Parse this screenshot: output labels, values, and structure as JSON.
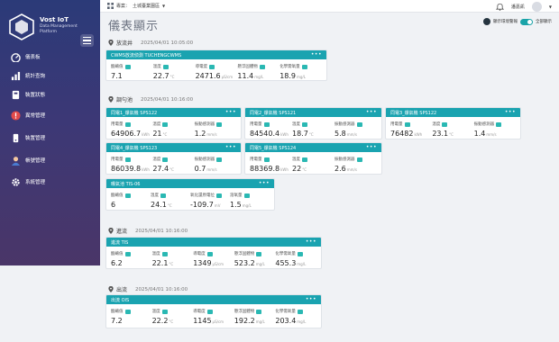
{
  "sidebar": {
    "brand_title": "Vost IoT",
    "brand_sub": "Data Management Platform",
    "items": [
      {
        "label": "儀表板",
        "icon": "dashboard-icon"
      },
      {
        "label": "統計查詢",
        "icon": "statistics-icon"
      },
      {
        "label": "裝置狀態",
        "icon": "device-status-icon"
      },
      {
        "label": "異常管理",
        "icon": "alert-icon"
      },
      {
        "label": "裝置管理",
        "icon": "device-icon"
      },
      {
        "label": "帳號管理",
        "icon": "user-icon"
      },
      {
        "label": "系統管理",
        "icon": "gear-icon"
      }
    ]
  },
  "topbar": {
    "region_label": "專案：",
    "region_value": "土城臺業園區",
    "user": "潘嘉凱"
  },
  "page": {
    "title": "儀表顯示",
    "toggle1_label": "顯示環境警報",
    "toggle2_label": "全部顯示"
  },
  "sections": [
    {
      "name": "放流井",
      "time": "2025/04/01 10:05:00",
      "cards": [
        {
          "title": "CWMS放流偵測 TUCHENGCWMS",
          "metrics": [
            {
              "label": "酸鹼值",
              "value": "7.1",
              "unit": ""
            },
            {
              "label": "溫度",
              "value": "22.7",
              "unit": "°C"
            },
            {
              "label": "導電度",
              "value": "2471.6",
              "unit": "µS/cm"
            },
            {
              "label": "懸浮固體物",
              "value": "11.4",
              "unit": "mg/L"
            },
            {
              "label": "化學需氧量",
              "value": "18.9",
              "unit": "mg/L"
            }
          ]
        }
      ]
    },
    {
      "name": "調勻池",
      "time": "2025/04/01 10:16:00",
      "cards": [
        {
          "title": "同電1_爆氣機 SPS122",
          "metrics": [
            {
              "label": "用電量",
              "value": "64906.7",
              "unit": "kWh"
            },
            {
              "label": "溫度",
              "value": "21",
              "unit": "°C"
            },
            {
              "label": "振動感測器",
              "value": "1.2",
              "unit": "mm/s"
            }
          ]
        },
        {
          "title": "同電2_爆氣機 SPS121",
          "metrics": [
            {
              "label": "用電量",
              "value": "84540.4",
              "unit": "kWh"
            },
            {
              "label": "溫度",
              "value": "18.7",
              "unit": "°C"
            },
            {
              "label": "振動感測器",
              "value": "5.8",
              "unit": "mm/s"
            }
          ]
        },
        {
          "title": "同電3_爆氣機 SPS122",
          "metrics": [
            {
              "label": "用電量",
              "value": "76482",
              "unit": "kWh"
            },
            {
              "label": "溫度",
              "value": "23.1",
              "unit": "°C"
            },
            {
              "label": "振動感測器",
              "value": "1.4",
              "unit": "mm/s"
            }
          ]
        },
        {
          "title": "同電4_爆氣機 SPS123",
          "metrics": [
            {
              "label": "用電量",
              "value": "86039.8",
              "unit": "kWh"
            },
            {
              "label": "溫度",
              "value": "27.4",
              "unit": "°C"
            },
            {
              "label": "振動感測器",
              "value": "0.7",
              "unit": "mm/s"
            }
          ]
        },
        {
          "title": "同電5_爆氣機 SPS124",
          "metrics": [
            {
              "label": "用電量",
              "value": "88369.8",
              "unit": "kWh"
            },
            {
              "label": "溫度",
              "value": "22",
              "unit": "°C"
            },
            {
              "label": "振動感測器",
              "value": "2.6",
              "unit": "mm/s"
            }
          ]
        },
        {
          "title": "曝氣池 TIS-06",
          "metrics": [
            {
              "label": "酸鹼值",
              "value": "6",
              "unit": ""
            },
            {
              "label": "溫度",
              "value": "24.1",
              "unit": "°C"
            },
            {
              "label": "氧化還原電位",
              "value": "-109.7",
              "unit": "mV"
            },
            {
              "label": "溶氧量",
              "value": "1.5",
              "unit": "mg/L"
            }
          ]
        }
      ]
    },
    {
      "name": "進流",
      "time": "2025/04/01 10:16:00",
      "cards": [
        {
          "title": "進流 TIS",
          "metrics": [
            {
              "label": "酸鹼值",
              "value": "6.2",
              "unit": ""
            },
            {
              "label": "溫度",
              "value": "22.1",
              "unit": "°C"
            },
            {
              "label": "導電度",
              "value": "1349",
              "unit": "µS/cm"
            },
            {
              "label": "懸浮固體物",
              "value": "523.2",
              "unit": "mg/L"
            },
            {
              "label": "化學需氧量",
              "value": "455.3",
              "unit": "mg/L"
            }
          ]
        }
      ]
    },
    {
      "name": "出流",
      "time": "2025/04/01 10:16:00",
      "cards": [
        {
          "title": "出流 OIS",
          "metrics": [
            {
              "label": "酸鹼值",
              "value": "7.2",
              "unit": ""
            },
            {
              "label": "溫度",
              "value": "22.2",
              "unit": "°C"
            },
            {
              "label": "導電度",
              "value": "1145",
              "unit": "µS/cm"
            },
            {
              "label": "懸浮固體物",
              "value": "192.2",
              "unit": "mg/L"
            },
            {
              "label": "化學需氧量",
              "value": "203.4",
              "unit": "mg/L"
            }
          ]
        }
      ]
    }
  ],
  "colors": {
    "accent": "#1aa3b0",
    "sidebar_top": "#2b3a78",
    "sidebar_bottom": "#4a3668"
  }
}
